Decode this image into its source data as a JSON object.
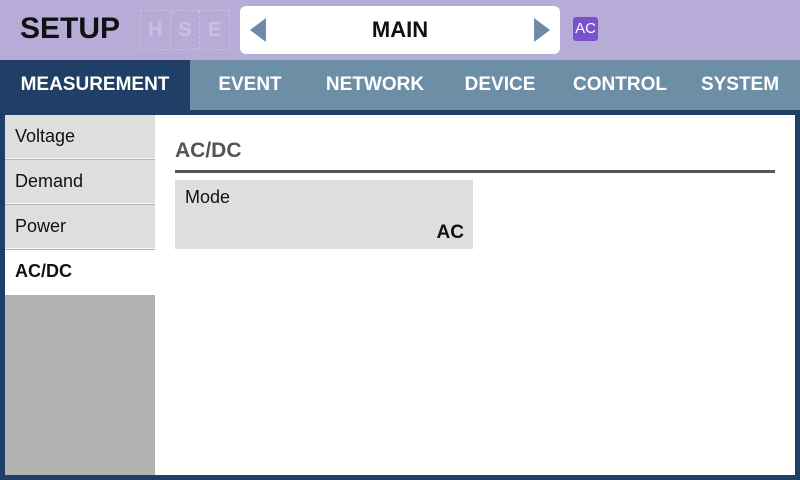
{
  "header": {
    "title": "SETUP",
    "hse": [
      "H",
      "S",
      "E"
    ],
    "selector_label": "MAIN",
    "badge": "AC"
  },
  "tabs": [
    {
      "label": "MEASUREMENT",
      "active": true
    },
    {
      "label": "EVENT",
      "active": false
    },
    {
      "label": "NETWORK",
      "active": false
    },
    {
      "label": "DEVICE",
      "active": false
    },
    {
      "label": "CONTROL",
      "active": false
    },
    {
      "label": "SYSTEM",
      "active": false
    }
  ],
  "sidebar": {
    "items": [
      {
        "label": "Voltage",
        "active": false
      },
      {
        "label": "Demand",
        "active": false
      },
      {
        "label": "Power",
        "active": false
      },
      {
        "label": "AC/DC",
        "active": true
      }
    ]
  },
  "content": {
    "section_title": "AC/DC",
    "field": {
      "label": "Mode",
      "value": "AC"
    }
  },
  "icons": {
    "prev": "triangle-left-icon",
    "next": "triangle-right-icon"
  },
  "colors": {
    "header_bg": "#b7acd8",
    "tab_bar": "#6d8fa6",
    "tab_active": "#1f3f66",
    "badge": "#7a52cc",
    "arrow": "#6f8aa5"
  }
}
